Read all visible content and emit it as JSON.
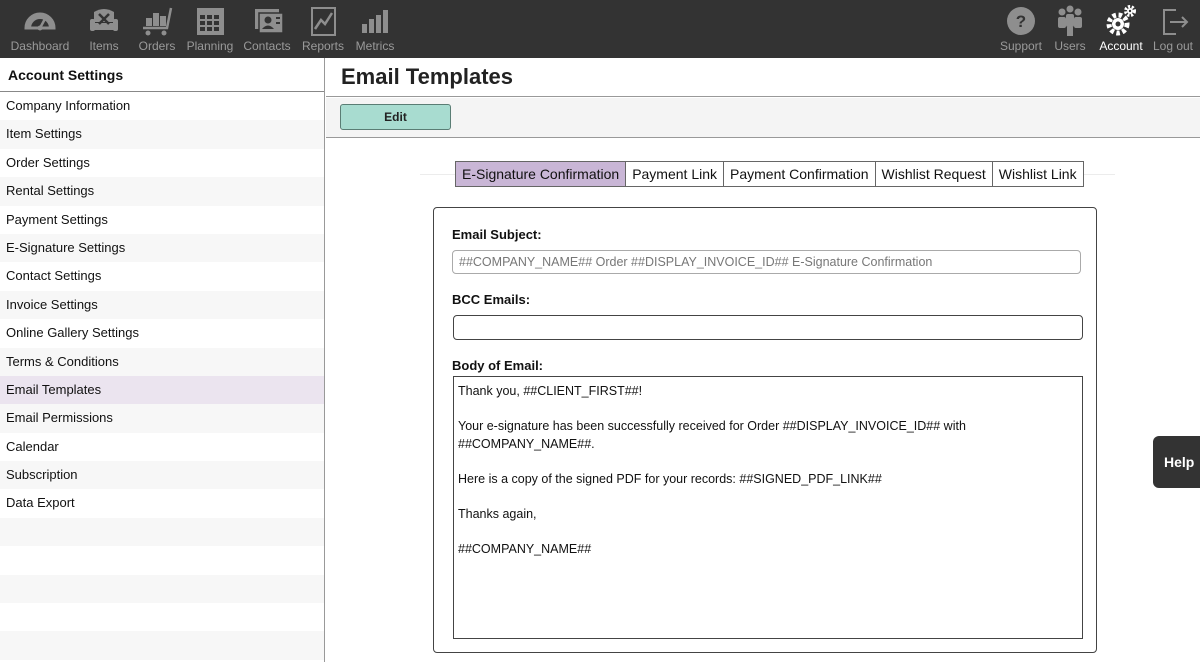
{
  "nav": {
    "left": [
      {
        "label": "Dashboard",
        "icon": "dashboard-gauge-icon"
      },
      {
        "label": "Items",
        "icon": "items-armchair-icon"
      },
      {
        "label": "Orders",
        "icon": "orders-cart-icon"
      },
      {
        "label": "Planning",
        "icon": "planning-calendar-icon"
      },
      {
        "label": "Contacts",
        "icon": "contacts-card-icon"
      },
      {
        "label": "Reports",
        "icon": "reports-chart-icon"
      },
      {
        "label": "Metrics",
        "icon": "metrics-bars-icon"
      }
    ],
    "right": [
      {
        "label": "Support",
        "icon": "support-question-icon"
      },
      {
        "label": "Users",
        "icon": "users-group-icon"
      },
      {
        "label": "Account",
        "icon": "account-gears-icon",
        "active": true
      },
      {
        "label": "Log out",
        "icon": "logout-arrow-icon"
      }
    ]
  },
  "sidebar": {
    "title": "Account Settings",
    "items": [
      {
        "label": "Company Information"
      },
      {
        "label": "Item Settings"
      },
      {
        "label": "Order Settings"
      },
      {
        "label": "Rental Settings"
      },
      {
        "label": "Payment Settings"
      },
      {
        "label": "E-Signature Settings"
      },
      {
        "label": "Contact Settings"
      },
      {
        "label": "Invoice Settings"
      },
      {
        "label": "Online Gallery Settings"
      },
      {
        "label": "Terms & Conditions"
      },
      {
        "label": "Email Templates",
        "active": true
      },
      {
        "label": "Email Permissions"
      },
      {
        "label": "Calendar"
      },
      {
        "label": "Subscription"
      },
      {
        "label": "Data Export"
      }
    ]
  },
  "main": {
    "title": "Email Templates",
    "edit_label": "Edit",
    "tabs": [
      {
        "label": "E-Signature Confirmation",
        "active": true
      },
      {
        "label": "Payment Link"
      },
      {
        "label": "Payment Confirmation"
      },
      {
        "label": "Wishlist Request"
      },
      {
        "label": "Wishlist Link"
      }
    ],
    "form": {
      "subject_label": "Email Subject:",
      "subject_value": "##COMPANY_NAME## Order ##DISPLAY_INVOICE_ID## E-Signature Confirmation",
      "bcc_label": "BCC  Emails:",
      "bcc_value": "",
      "body_label": "Body of Email:",
      "body_lines": [
        "Thank you, ##CLIENT_FIRST##!",
        "",
        "Your e-signature has been successfully received for Order ##DISPLAY_INVOICE_ID## with",
        "##COMPANY_NAME##.",
        "",
        "Here is a copy of the signed PDF for your records: ##SIGNED_PDF_LINK##",
        "",
        "Thanks again,",
        "",
        "##COMPANY_NAME##"
      ]
    }
  },
  "help_label": "Help",
  "colors": {
    "nav_bg": "#333333",
    "edit_button": "#a8dcd0",
    "active_tab": "#c9b6d6",
    "active_sidebar": "#ebe4ef"
  }
}
